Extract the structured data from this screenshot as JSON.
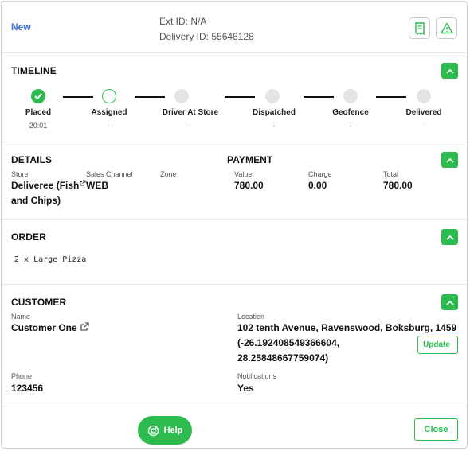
{
  "header": {
    "status": "New",
    "ext_id": "Ext ID: N/A",
    "delivery_id": "Delivery ID: 55648128",
    "icons": [
      "receipt-icon",
      "warning-icon"
    ]
  },
  "timeline": {
    "title": "TIMELINE",
    "steps": [
      {
        "label": "Placed",
        "time": "20:01",
        "state": "done"
      },
      {
        "label": "Assigned",
        "time": "-",
        "state": "current"
      },
      {
        "label": "Driver At Store",
        "time": "-",
        "state": "pending"
      },
      {
        "label": "Dispatched",
        "time": "-",
        "state": "pending"
      },
      {
        "label": "Geofence",
        "time": "-",
        "state": "pending"
      },
      {
        "label": "Delivered",
        "time": "-",
        "state": "pending"
      }
    ]
  },
  "details": {
    "title": "DETAILS",
    "store_label": "Store",
    "store_value": "Deliveree (Fish and Chips)",
    "channel_label": "Sales Channel",
    "channel_value": "WEB",
    "zone_label": "Zone",
    "zone_value": ""
  },
  "payment": {
    "title": "PAYMENT",
    "value_label": "Value",
    "value_value": "780.00",
    "charge_label": "Charge",
    "charge_value": "0.00",
    "total_label": "Total",
    "total_value": "780.00"
  },
  "order": {
    "title": "ORDER",
    "items": [
      "2 x Large Pizza"
    ]
  },
  "customer": {
    "title": "CUSTOMER",
    "name_label": "Name",
    "name_value": "Customer One",
    "location_label": "Location",
    "location_line1": "102 tenth Avenue, Ravenswood, Boksburg, 1459",
    "location_line2": "(-26.192408549366604,",
    "location_line3": "28.25848667759074)",
    "update_label": "Update",
    "phone_label": "Phone",
    "phone_value": "123456",
    "notifications_label": "Notifications",
    "notifications_value": "Yes"
  },
  "footer": {
    "help_label": "Help",
    "close_label": "Close"
  },
  "colors": {
    "accent": "#2dbb4f",
    "status_new": "#3a6fd8",
    "pending_dot": "#e4e4e4"
  }
}
